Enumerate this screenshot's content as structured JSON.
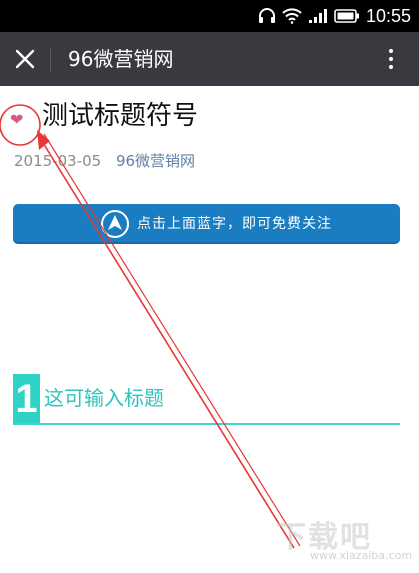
{
  "status_bar": {
    "time": "10:55",
    "battery_icon": "battery-icon",
    "signal_icon": "signal-icon",
    "wifi_icon": "wifi-icon",
    "headphones_icon": "headphones-icon"
  },
  "app_bar": {
    "title": "96微营销网",
    "close_icon": "close-icon",
    "more_icon": "more-vertical-icon"
  },
  "article": {
    "title": "测试标题符号",
    "date": "2015-03-05",
    "source": "96微营销网",
    "follow_banner": "点击上面蓝字，即可免费关注",
    "section": {
      "number": "1",
      "title": "这可输入标题"
    }
  },
  "watermark": {
    "text": "下载吧",
    "sub": "www.xiazaiba.com"
  },
  "colors": {
    "app_bar": "#393a3f",
    "banner": "#1a7dc2",
    "accent_teal": "#2fd3c5",
    "source_link": "#607fa6",
    "annotation": "#e53935"
  }
}
